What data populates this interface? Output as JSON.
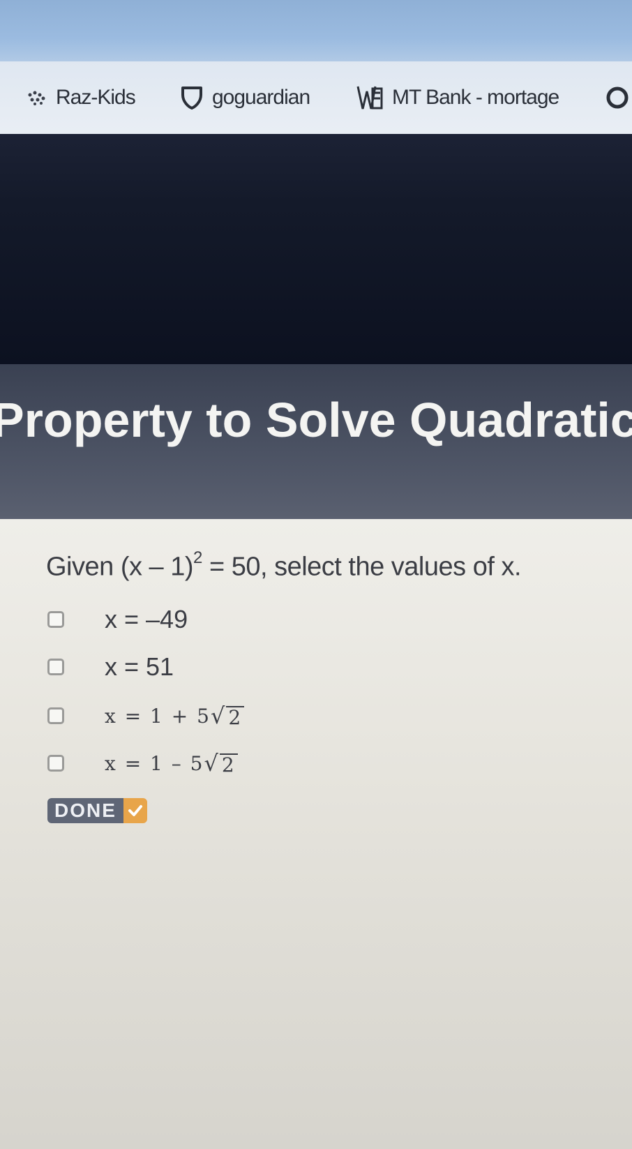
{
  "bookmarks": [
    {
      "label": "Raz-Kids",
      "icon": "raz-kids-icon"
    },
    {
      "label": "goguardian",
      "icon": "goguardian-shield-icon"
    },
    {
      "label": "MT Bank - mortage",
      "icon": "mt-bank-icon"
    }
  ],
  "page": {
    "title": "Property to Solve Quadratic"
  },
  "question": {
    "prefix": "Given (x – 1)",
    "exponent": "2",
    "suffix": " = 50, select the values of x."
  },
  "options": [
    {
      "label": "x = –49"
    },
    {
      "label": "x = 51"
    },
    {
      "prefix": "x = 1 + 5",
      "radicand": "2"
    },
    {
      "prefix": "x = 1 – 5",
      "radicand": "2"
    }
  ],
  "done_button": {
    "label": "DONE"
  },
  "colors": {
    "header_dark": "#0c1120",
    "title_band": "#4b5263",
    "content_bg": "#e6e4dd",
    "done_bg": "#5f6676",
    "done_accent": "#e8a54a"
  }
}
